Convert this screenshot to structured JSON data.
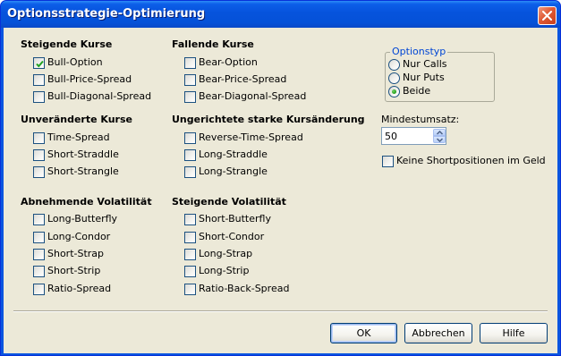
{
  "window": {
    "title": "Optionsstrategie-Optimierung"
  },
  "groups": [
    {
      "title": "Steigende Kurse",
      "items": [
        {
          "label": "Bull-Option",
          "checked": true
        },
        {
          "label": "Bull-Price-Spread",
          "checked": false
        },
        {
          "label": "Bull-Diagonal-Spread",
          "checked": false
        }
      ]
    },
    {
      "title": "Fallende Kurse",
      "items": [
        {
          "label": "Bear-Option",
          "checked": false
        },
        {
          "label": "Bear-Price-Spread",
          "checked": false
        },
        {
          "label": "Bear-Diagonal-Spread",
          "checked": false
        }
      ]
    },
    {
      "title": "Unveränderte Kurse",
      "items": [
        {
          "label": "Time-Spread",
          "checked": false
        },
        {
          "label": "Short-Straddle",
          "checked": false
        },
        {
          "label": "Short-Strangle",
          "checked": false
        }
      ]
    },
    {
      "title": "Ungerichtete starke Kursänderung",
      "items": [
        {
          "label": "Reverse-Time-Spread",
          "checked": false
        },
        {
          "label": "Long-Straddle",
          "checked": false
        },
        {
          "label": "Long-Strangle",
          "checked": false
        }
      ]
    },
    {
      "title": "Abnehmende Volatilität",
      "items": [
        {
          "label": "Long-Butterfly",
          "checked": false
        },
        {
          "label": "Long-Condor",
          "checked": false
        },
        {
          "label": "Short-Strap",
          "checked": false
        },
        {
          "label": "Short-Strip",
          "checked": false
        },
        {
          "label": "Ratio-Spread",
          "checked": false
        }
      ]
    },
    {
      "title": "Steigende Volatilität",
      "items": [
        {
          "label": "Short-Butterfly",
          "checked": false
        },
        {
          "label": "Short-Condor",
          "checked": false
        },
        {
          "label": "Long-Strap",
          "checked": false
        },
        {
          "label": "Long-Strip",
          "checked": false
        },
        {
          "label": "Ratio-Back-Spread",
          "checked": false
        }
      ]
    }
  ],
  "option_type": {
    "legend": "Optionstyp",
    "options": [
      {
        "label": "Nur Calls",
        "selected": false
      },
      {
        "label": "Nur Puts",
        "selected": false
      },
      {
        "label": "Beide",
        "selected": true
      }
    ]
  },
  "min_turnover": {
    "label": "Mindestumsatz:",
    "value": "50"
  },
  "no_short_itm": {
    "label": "Keine Shortpositionen im Geld",
    "checked": false
  },
  "buttons": {
    "ok": "OK",
    "cancel": "Abbrechen",
    "help": "Hilfe"
  },
  "colors": {
    "titlebar": "#0653dc",
    "dialog_bg": "#ece9d8",
    "legend_text": "#0046d5",
    "radio_dot": "#2aa51f"
  }
}
